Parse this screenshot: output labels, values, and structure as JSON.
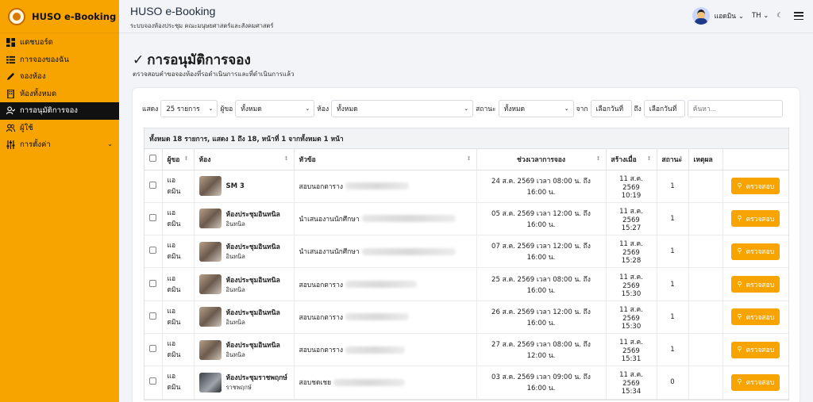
{
  "brand": {
    "name": "HUSO e-Booking"
  },
  "header": {
    "title": "HUSO e-Booking",
    "subtitle": "ระบบจองห้องประชุม คณะมนุษยศาสตร์และสังคมศาสตร์",
    "user_name": "แอดมิน",
    "language": "TH"
  },
  "sidebar": {
    "items": [
      {
        "label": "แดชบอร์ด",
        "icon": "dashboard-icon"
      },
      {
        "label": "การจองของฉัน",
        "icon": "list-icon"
      },
      {
        "label": "จองห้อง",
        "icon": "pencil-icon"
      },
      {
        "label": "ห้องทั้งหมด",
        "icon": "building-icon"
      },
      {
        "label": "การอนุมัติการจอง",
        "icon": "user-check-icon"
      },
      {
        "label": "ผู้ใช้",
        "icon": "users-icon"
      },
      {
        "label": "การตั้งค่า",
        "icon": "sliders-icon"
      }
    ]
  },
  "page": {
    "title": "การอนุมัติการจอง",
    "subtitle": "ตรวจสอบคำขอจองห้องที่รอดำเนินการและที่ดำเนินการแล้ว"
  },
  "filters": {
    "show_label": "แสดง",
    "show_value": "25 รายการ",
    "requester_label": "ผู้ขอ",
    "requester_value": "ทั้งหมด",
    "room_label": "ห้อง",
    "room_value": "ทั้งหมด",
    "status_label": "สถานะ",
    "status_value": "ทั้งหมด",
    "from_label": "จาก",
    "from_value": "เลือกวันที่",
    "to_label": "ถึง",
    "to_value": "เลือกวันที่",
    "search_placeholder": "ค้นหา..."
  },
  "table": {
    "summary": "ทั้งหมด 18 รายการ, แสดง 1 ถึง 18, หน้าที่ 1 จากทั้งหมด 1 หน้า",
    "columns": [
      "ผู้ขอ",
      "ห้อง",
      "หัวข้อ",
      "ช่วงเวลาการจอง",
      "สร้างเมื่อ",
      "สถานะ",
      "เหตุผล"
    ],
    "action_label": "ตรวจสอบ",
    "rows": [
      {
        "requester": "แอดมิน",
        "room": "SM 3",
        "room_sub": "",
        "subject": "สอบนอกตาราง",
        "time": "24 ส.ค. 2569 เวลา 08:00 น. ถึง 16:00 น.",
        "created_date": "11 ส.ค. 2569",
        "created_time": "10:19",
        "status": "1"
      },
      {
        "requester": "แอดมิน",
        "room": "ห้องประชุมอินทนิล",
        "room_sub": "อินทนิล",
        "subject": "นำเสนองานนักศึกษา",
        "time": "05 ส.ค. 2569 เวลา 12:00 น. ถึง 16:00 น.",
        "created_date": "11 ส.ค. 2569",
        "created_time": "15:27",
        "status": "1"
      },
      {
        "requester": "แอดมิน",
        "room": "ห้องประชุมอินทนิล",
        "room_sub": "อินทนิล",
        "subject": "นำเสนองานนักศึกษา",
        "time": "07 ส.ค. 2569 เวลา 12:00 น. ถึง 16:00 น.",
        "created_date": "11 ส.ค. 2569",
        "created_time": "15:28",
        "status": "1"
      },
      {
        "requester": "แอดมิน",
        "room": "ห้องประชุมอินทนิล",
        "room_sub": "อินทนิล",
        "subject": "สอบนอกตาราง",
        "time": "25 ส.ค. 2569 เวลา 08:00 น. ถึง 16:00 น.",
        "created_date": "11 ส.ค. 2569",
        "created_time": "15:30",
        "status": "1"
      },
      {
        "requester": "แอดมิน",
        "room": "ห้องประชุมอินทนิล",
        "room_sub": "อินทนิล",
        "subject": "สอบนอกตาราง",
        "time": "26 ส.ค. 2569 เวลา 12:00 น. ถึง 16:00 น.",
        "created_date": "11 ส.ค. 2569",
        "created_time": "15:30",
        "status": "1"
      },
      {
        "requester": "แอดมิน",
        "room": "ห้องประชุมอินทนิล",
        "room_sub": "อินทนิล",
        "subject": "สอบนอกตาราง",
        "time": "27 ส.ค. 2569 เวลา 08:00 น. ถึง 12:00 น.",
        "created_date": "11 ส.ค. 2569",
        "created_time": "15:31",
        "status": "1"
      },
      {
        "requester": "แอดมิน",
        "room": "ห้องประชุมราชพฤกษ์",
        "room_sub": "ราชพฤกษ์",
        "subject": "สอบชดเชย",
        "time": "03 ส.ค. 2569 เวลา 09:00 น. ถึง 16:00 น.",
        "created_date": "11 ส.ค. 2569",
        "created_time": "15:34",
        "status": "0"
      }
    ]
  },
  "colors": {
    "accent": "#f7a400",
    "sidebar_active": "#111111"
  }
}
